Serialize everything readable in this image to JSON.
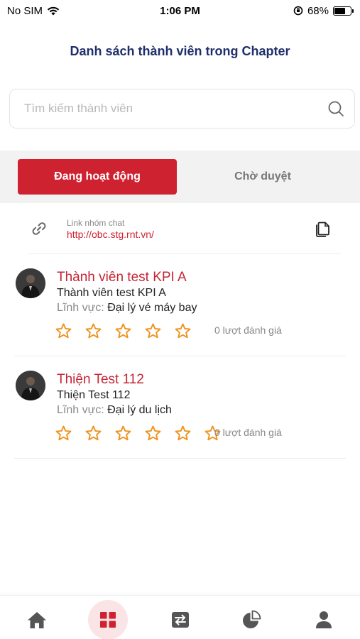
{
  "status_bar": {
    "carrier": "No SIM",
    "time": "1:06 PM",
    "battery": "68%",
    "battery_level": 0.68
  },
  "header": {
    "title": "Danh sách thành viên trong Chapter"
  },
  "search": {
    "placeholder": "Tìm kiếm thành viên",
    "value": ""
  },
  "tabs": [
    {
      "label": "Đang hoạt động",
      "active": true
    },
    {
      "label": "Chờ duyệt",
      "active": false
    }
  ],
  "chat_link": {
    "label": "Link nhóm chat",
    "url": "http://obc.stg.rnt.vn/"
  },
  "members": [
    {
      "name": "Thành viên test KPI A",
      "subtitle": "Thành viên test KPI A",
      "field_label": "Lĩnh vực:",
      "field_value": "Đại lý vé máy bay",
      "rating": 0,
      "rating_count": "0 lượt đánh giá"
    },
    {
      "name": "Thiện Test 112",
      "subtitle": "Thiện Test 112",
      "field_label": "Lĩnh vực:",
      "field_value": "Đại lý du lịch",
      "rating": 0,
      "rating_count": "0 lượt đánh giá"
    }
  ],
  "bottom_nav": [
    {
      "icon": "home-icon",
      "active": false
    },
    {
      "icon": "grid-icon",
      "active": true
    },
    {
      "icon": "transfer-icon",
      "active": false
    },
    {
      "icon": "pie-chart-icon",
      "active": false
    },
    {
      "icon": "person-icon",
      "active": false
    }
  ],
  "colors": {
    "brand_red": "#cf2230",
    "title_navy": "#1e2f6b",
    "star_orange": "#f0931e"
  }
}
